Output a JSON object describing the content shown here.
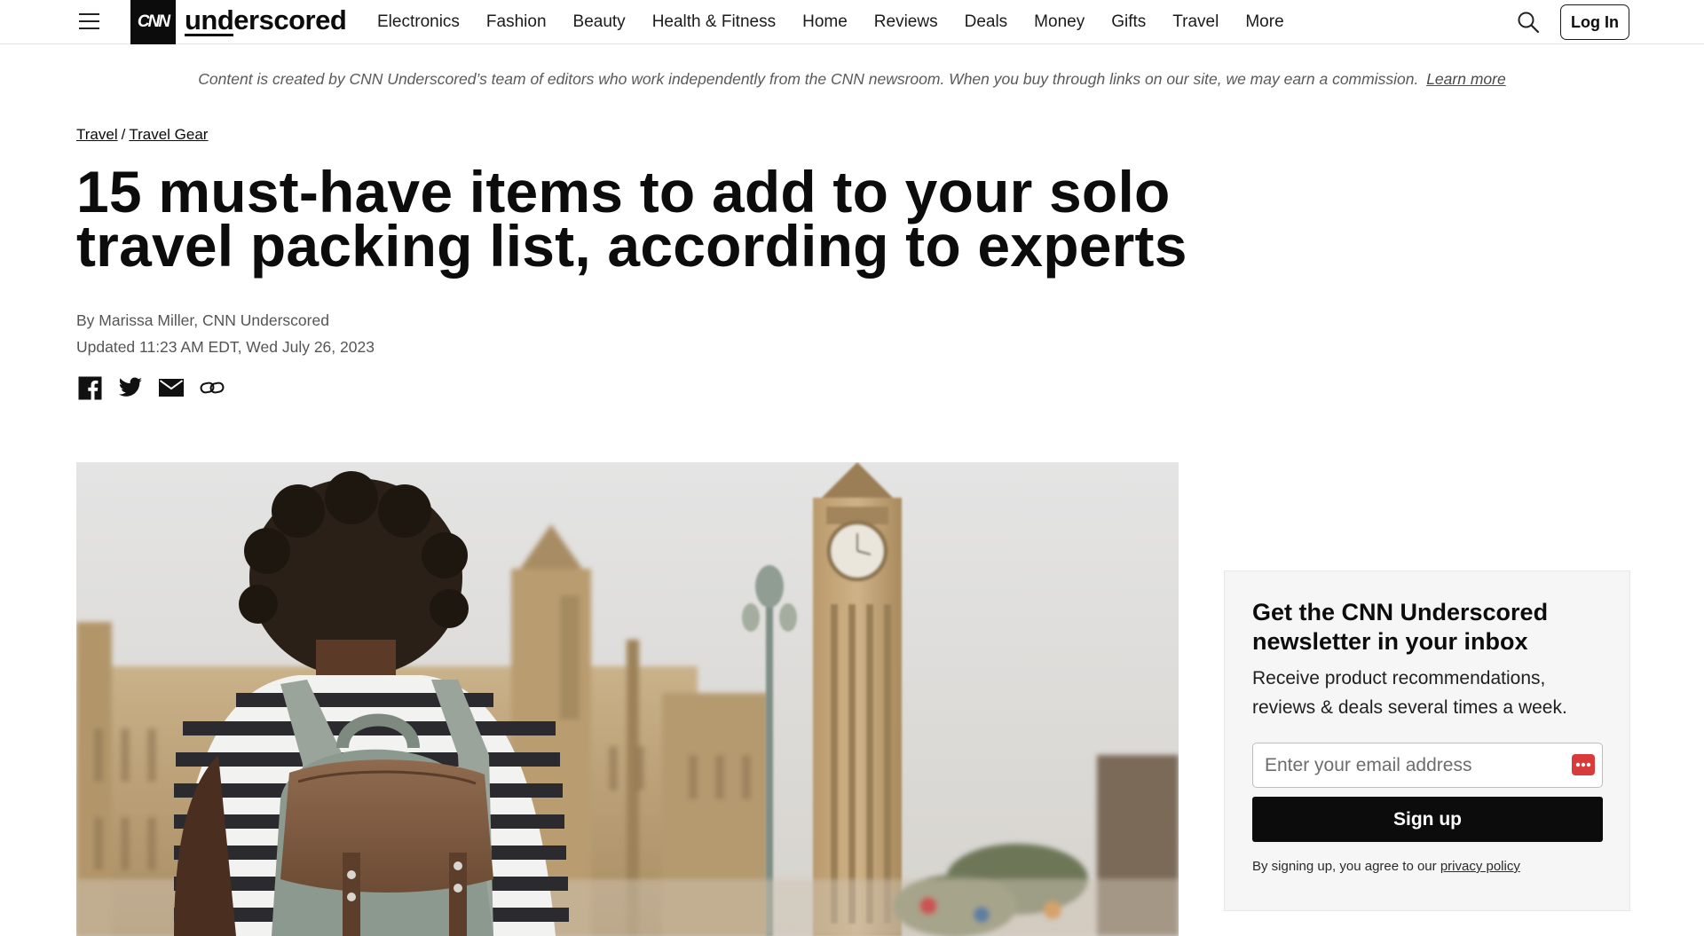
{
  "header": {
    "logo_mark": "CNN",
    "logo_word": "underscored",
    "nav": [
      "Electronics",
      "Fashion",
      "Beauty",
      "Health & Fitness",
      "Home",
      "Reviews",
      "Deals",
      "Money",
      "Gifts",
      "Travel",
      "More"
    ],
    "login_label": "Log In",
    "icons": [
      "hamburger-menu-icon",
      "search-icon"
    ]
  },
  "disclosure": {
    "text": "Content is created by CNN Underscored’s team of editors who work independently from the CNN newsroom. When you buy through links on our site, we may earn a commission.",
    "link_label": "Learn more"
  },
  "breadcrumb": {
    "items": [
      "Travel",
      "Travel Gear"
    ],
    "separator": "/"
  },
  "article": {
    "title": "15 must-have items to add to your solo travel packing list, according to experts",
    "author": "By Marissa Miller, CNN Underscored",
    "updated": "Updated 11:23 AM EDT, Wed July 26, 2023",
    "share_icons": [
      "facebook-icon",
      "twitter-icon",
      "email-icon",
      "link-icon"
    ]
  },
  "newsletter": {
    "title": "Get the CNN Underscored newsletter in your inbox",
    "description": "Receive product recommendations, reviews & deals several times a week.",
    "email_placeholder": "Enter your email address",
    "button_label": "Sign up",
    "legal_prefix": "By signing up, you agree to our",
    "legal_link": "privacy policy"
  },
  "colors": {
    "brand_black": "#0c0c0c",
    "panel_bg": "#f6f6f6",
    "password_manager_red": "#d93a3a"
  }
}
